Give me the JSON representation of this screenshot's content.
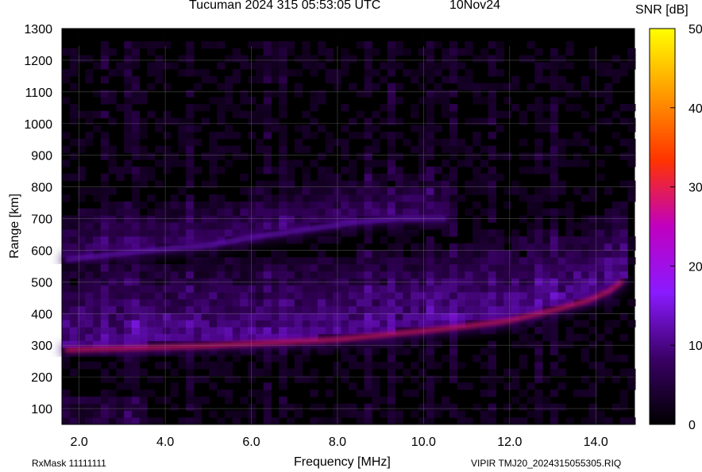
{
  "header": {
    "title": "Tucuman 2024 315 05:53:05 UTC",
    "date": "10Nov24",
    "colorbar_label": "SNR [dB]"
  },
  "footer": {
    "rxmask": "RxMask 11111111",
    "file": "VIPIR  TMJ20_2024315055305.RIQ"
  },
  "chart_data": {
    "type": "heatmap",
    "title": "Tucuman 2024 315 05:53:05 UTC",
    "xlabel": "Frequency [MHz]",
    "ylabel": "Range [km]",
    "xlim": [
      1.6,
      14.9
    ],
    "ylim": [
      50,
      1300
    ],
    "x_ticks": [
      "2.0",
      "4.0",
      "6.0",
      "8.0",
      "10.0",
      "12.0",
      "14.0"
    ],
    "x_tick_values": [
      2,
      4,
      6,
      8,
      10,
      12,
      14
    ],
    "y_ticks": [
      "100",
      "200",
      "300",
      "400",
      "500",
      "600",
      "700",
      "800",
      "900",
      "1000",
      "1100",
      "1200",
      "1300"
    ],
    "y_tick_values": [
      100,
      200,
      300,
      400,
      500,
      600,
      700,
      800,
      900,
      1000,
      1100,
      1200,
      1300
    ],
    "colorbar": {
      "label": "SNR [dB]",
      "range": [
        0,
        50
      ],
      "ticks": [
        "0",
        "10",
        "20",
        "30",
        "40",
        "50"
      ],
      "tick_values": [
        0,
        10,
        20,
        30,
        40,
        50
      ],
      "colormap": [
        "#000000",
        "#3a0066",
        "#8a1aff",
        "#c000c0",
        "#ff3300",
        "#ff9900",
        "#ffff00"
      ]
    },
    "data_ceiling_km": 1245,
    "traces": [
      {
        "id": "F-trace",
        "snr_db": [
          10,
          30
        ],
        "points": [
          [
            1.7,
            285
          ],
          [
            3.0,
            290
          ],
          [
            5.0,
            298
          ],
          [
            6.0,
            305
          ],
          [
            8.0,
            318
          ],
          [
            10.0,
            345
          ],
          [
            11.0,
            360
          ],
          [
            12.0,
            378
          ],
          [
            13.0,
            410
          ],
          [
            13.8,
            440
          ],
          [
            14.3,
            470
          ],
          [
            14.6,
            500
          ]
        ]
      },
      {
        "id": "multihop-trace",
        "snr_db": [
          8,
          14
        ],
        "points": [
          [
            1.7,
            570
          ],
          [
            3.0,
            590
          ],
          [
            4.5,
            610
          ],
          [
            5.0,
            615
          ],
          [
            6.0,
            640
          ],
          [
            7.5,
            670
          ],
          [
            8.5,
            690
          ],
          [
            9.5,
            700
          ],
          [
            10.5,
            700
          ]
        ]
      }
    ]
  }
}
